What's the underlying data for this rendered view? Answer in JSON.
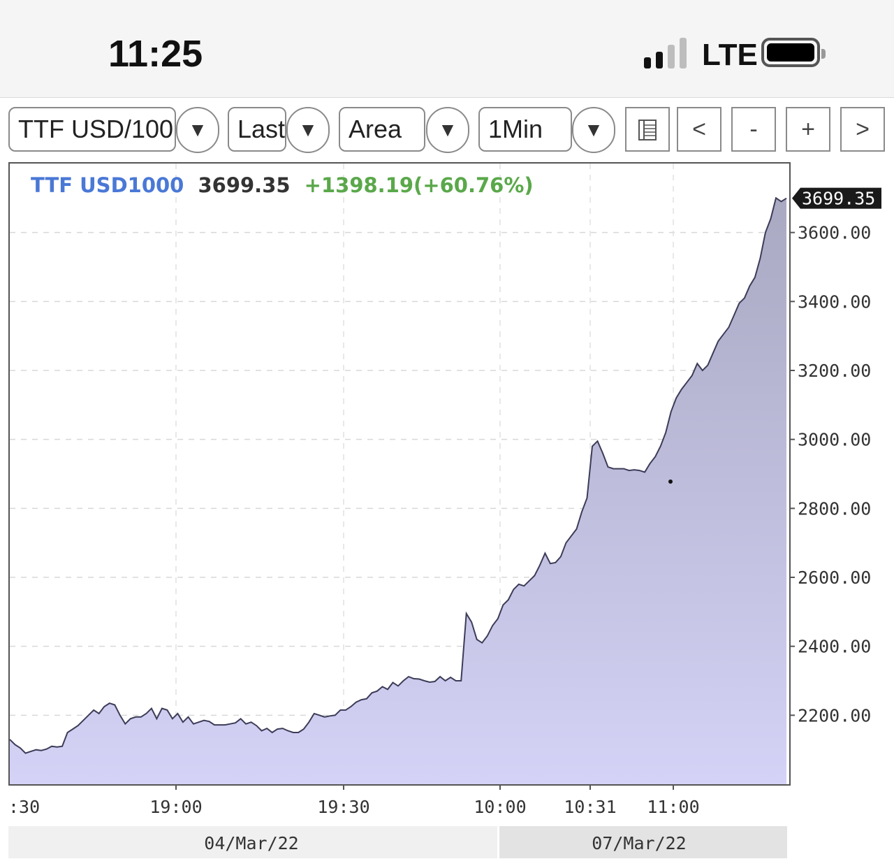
{
  "status_bar": {
    "time": "11:25",
    "network": "LTE",
    "signal_bars": 2,
    "signal_bars_total": 4
  },
  "toolbar": {
    "symbol_select": "TTF USD/100",
    "price_type_select": "Last",
    "chart_type_select": "Area",
    "interval_select": "1Min",
    "dropdown_arrow": "▼",
    "table_button_icon": "table-icon",
    "prev_button": "<",
    "zoom_out_button": "-",
    "zoom_in_button": "+",
    "next_button": ">"
  },
  "chart_header": {
    "symbol": "TTF USD1000",
    "last": "3699.35",
    "change": "+1398.19(+60.76%)"
  },
  "colors": {
    "symbol": "#4a78d6",
    "change": "#5aa84a",
    "area_fill_top": "#a9a9c2",
    "area_fill_bottom": "#d4d2f6",
    "line": "#3c3c58"
  },
  "chart_data": {
    "type": "area",
    "title": "",
    "xlabel": "",
    "ylabel": "",
    "ylim": [
      2000,
      3800
    ],
    "y_ticks": [
      "2200.00",
      "2400.00",
      "2600.00",
      "2800.00",
      "3000.00",
      "3200.00",
      "3400.00",
      "3600.00"
    ],
    "last_value_label": "3699.35",
    "x_tick_labels": [
      ":30",
      "19:00",
      "19:30",
      "10:00",
      "10:31",
      "11:00"
    ],
    "date_labels": [
      "04/Mar/22",
      "07/Mar/22"
    ],
    "grid": true,
    "series": [
      {
        "values": [
          2130,
          2115,
          2105,
          2090,
          2095,
          2100,
          2098,
          2102,
          2110,
          2108,
          2110,
          2150,
          2160,
          2170,
          2185,
          2200,
          2215,
          2205,
          2225,
          2235,
          2230,
          2200,
          2175,
          2190,
          2195,
          2195,
          2205,
          2220,
          2190,
          2220,
          2215,
          2190,
          2205,
          2180,
          2195,
          2175,
          2180,
          2185,
          2182,
          2172,
          2172,
          2172,
          2175,
          2178,
          2190,
          2175,
          2180,
          2170,
          2155,
          2162,
          2150,
          2160,
          2162,
          2155,
          2150,
          2150,
          2160,
          2180,
          2205,
          2200,
          2195,
          2198,
          2200,
          2215,
          2215,
          2225,
          2238,
          2245,
          2248,
          2265,
          2270,
          2283,
          2275,
          2295,
          2285,
          2300,
          2312,
          2306,
          2305,
          2300,
          2296,
          2298,
          2312,
          2300,
          2310,
          2300,
          2300,
          2495,
          2470,
          2420,
          2410,
          2430,
          2460,
          2480,
          2520,
          2535,
          2565,
          2580,
          2575,
          2590,
          2605,
          2635,
          2670,
          2640,
          2643,
          2660,
          2700,
          2720,
          2740,
          2790,
          2830,
          2980,
          2995,
          2960,
          2920,
          2915,
          2915,
          2915,
          2910,
          2912,
          2910,
          2905,
          2930,
          2950,
          2980,
          3020,
          3080,
          3120,
          3145,
          3165,
          3185,
          3220,
          3200,
          3215,
          3250,
          3285,
          3305,
          3325,
          3360,
          3395,
          3410,
          3445,
          3470,
          3525,
          3600,
          3640,
          3700,
          3690,
          3699.35
        ]
      }
    ]
  }
}
